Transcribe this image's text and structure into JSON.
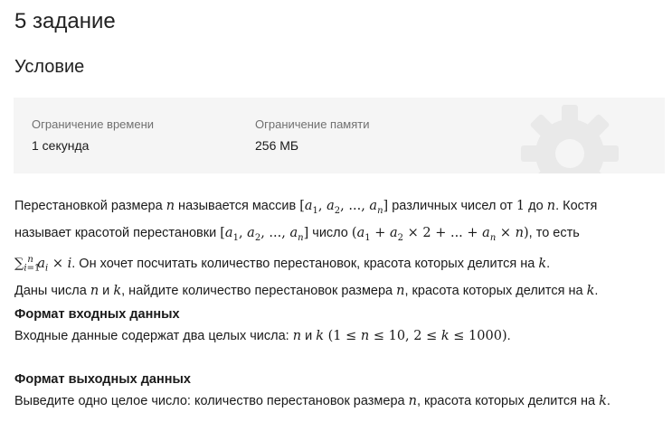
{
  "task": {
    "title": "5 задание"
  },
  "condition": {
    "title": "Условие"
  },
  "limits": {
    "time_label": "Ограничение времени",
    "time_value": "1 секунда",
    "memory_label": "Ограничение памяти",
    "memory_value": "256 МБ"
  },
  "statement": {
    "line1_a": "Перестановкой размера ",
    "line1_b": " называется массив ",
    "line1_c": " различных чисел от ",
    "line1_d": " до ",
    "line1_e": ". Костя",
    "line2_a": "называет красотой перестановки ",
    "line2_b": " число ",
    "line2_c": ", то есть",
    "line3_b": ". Он хочет посчитать количество перестановок, красота которых делится на ",
    "line3_c": ".",
    "line4_a": "Даны числа ",
    "line4_b": " и ",
    "line4_c": ", найдите количество перестановок размера ",
    "line4_d": ", красота которых делится на ",
    "line4_e": "."
  },
  "input_format": {
    "title": "Формат входных данных",
    "text_a": "Входные данные содержат два целых числа: ",
    "text_b": " и ",
    "text_c": "."
  },
  "output_format": {
    "title": "Формат выходных данных",
    "text_a": "Выведите одно целое число: количество перестановок размера ",
    "text_b": ", красота которых делится на ",
    "text_c": "."
  },
  "icons": {
    "panel_watermark": "gear-icon"
  },
  "colors": {
    "panel_bg": "#f5f5f5",
    "label_gray": "#707070",
    "watermark": "#e9e9e9"
  }
}
